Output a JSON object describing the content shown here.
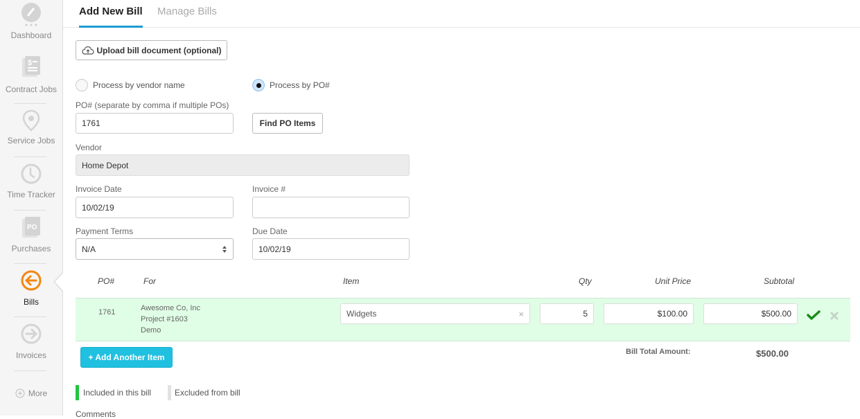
{
  "sidebar": {
    "items": [
      {
        "label": "Dashboard",
        "icon": "dashboard-gauge-icon",
        "active": false
      },
      {
        "label": "Contract Jobs",
        "icon": "contract-document-icon",
        "active": false
      },
      {
        "label": "Service Jobs",
        "icon": "map-pin-icon",
        "active": false
      },
      {
        "label": "Time Tracker",
        "icon": "clock-icon",
        "active": false
      },
      {
        "label": "Purchases",
        "icon": "po-document-icon",
        "active": false
      },
      {
        "label": "Bills",
        "icon": "arrow-left-circle-icon",
        "active": true
      },
      {
        "label": "Invoices",
        "icon": "arrow-right-circle-icon",
        "active": false
      }
    ],
    "more_label": "More",
    "po_badge": "PO",
    "active_color": "#f5860f"
  },
  "tabs": [
    {
      "label": "Add New Bill",
      "active": true
    },
    {
      "label": "Manage Bills",
      "active": false
    }
  ],
  "form": {
    "upload_label": "Upload bill document (optional)",
    "radio_vendor_label": "Process by vendor name",
    "radio_po_label": "Process by PO#",
    "selected_mode": "po",
    "po_label": "PO# (separate by comma if multiple POs)",
    "po_value": "1761",
    "find_po_label": "Find PO Items",
    "vendor_label": "Vendor",
    "vendor_value": "Home Depot",
    "invoice_date_label": "Invoice Date",
    "invoice_date_value": "10/02/19",
    "invoice_num_label": "Invoice #",
    "invoice_num_value": "",
    "payment_terms_label": "Payment Terms",
    "payment_terms_value": "N/A",
    "due_date_label": "Due Date",
    "due_date_value": "10/02/19"
  },
  "table": {
    "headers": {
      "po": "PO#",
      "for": "For",
      "item": "Item",
      "qty": "Qty",
      "unit_price": "Unit Price",
      "subtotal": "Subtotal"
    },
    "rows": [
      {
        "po": "1761",
        "for_lines": [
          "Awesome Co, Inc",
          "Project #1603",
          "Demo"
        ],
        "item": "Widgets",
        "qty": "5",
        "unit_price": "$100.00",
        "subtotal": "$500.00",
        "included": true
      }
    ],
    "add_item_label": "+ Add Another Item",
    "total_label": "Bill Total Amount:",
    "total_value": "$500.00"
  },
  "legend": {
    "included_label": "Included in this bill",
    "included_color": "#22c542",
    "excluded_label": "Excluded from bill",
    "excluded_color": "#e2e2e2"
  },
  "comments_label": "Comments"
}
